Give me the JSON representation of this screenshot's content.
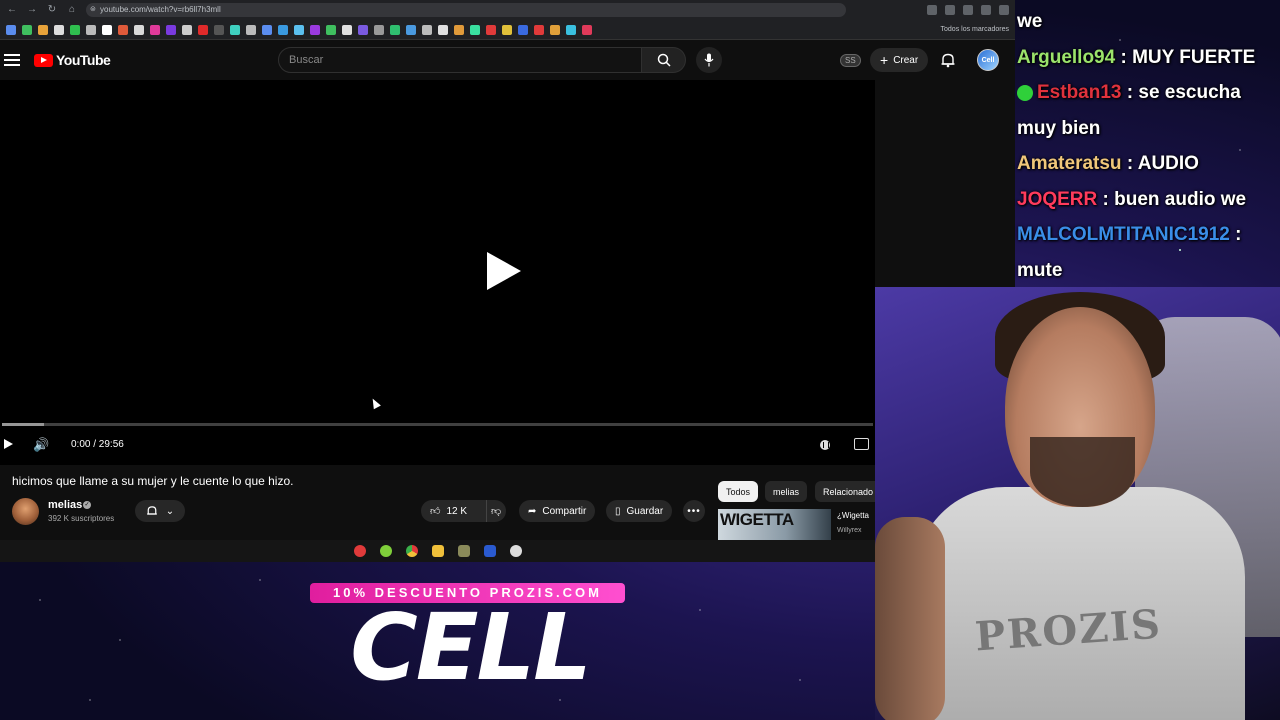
{
  "browser": {
    "url": "youtube.com/watch?v=rb6ll7h3mll",
    "bookmarks_all_label": "Todos los marcadores"
  },
  "youtube": {
    "logo_text": "YouTube",
    "search_placeholder": "Buscar",
    "badge": "SS",
    "create_label": "Crear",
    "avatar_text": "Cell"
  },
  "player": {
    "time": "0:00 / 29:56",
    "progress": 0
  },
  "video": {
    "title": "hicimos que llame a su mujer y le cuente lo que hizo.",
    "channel": "melias",
    "subscribers": "392 K suscriptores",
    "likes": "12 K",
    "share_label": "Compartir",
    "save_label": "Guardar"
  },
  "chips": [
    "Todos",
    "melias",
    "Relacionado"
  ],
  "recommendation": {
    "thumb_text": "WIGETTA",
    "title": "¿Wigetta",
    "channel": "Willyrex"
  },
  "chat": [
    {
      "user": "Arguello94",
      "text": "MUY FUERTE",
      "color": "#9be36b"
    },
    {
      "user": "Estban13",
      "text": "se escucha muy bien",
      "color": "#e0323d",
      "badge": true
    },
    {
      "user": "Amateratsu",
      "text": "AUDIO",
      "color": "#f0c77a"
    },
    {
      "user": "JOQERR",
      "text": "buen audio we",
      "color": "#ff3b5c"
    },
    {
      "user": "MALCOLMTITANIC1912",
      "text": "mute",
      "color": "#3a8ee8"
    }
  ],
  "chat_partial_top": "we",
  "webcam": {
    "shirt_text": "PROZIS"
  },
  "promo": {
    "subline": "10% DESCUENTO PROZIS.COM",
    "main": "CELL"
  }
}
